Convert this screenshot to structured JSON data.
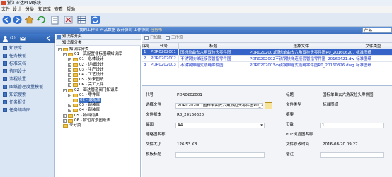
{
  "window": {
    "title": "浙江亚达PLM系统"
  },
  "menu": [
    "文件",
    "设计",
    "分类",
    "知识库",
    "查看",
    "帮助"
  ],
  "toolbar": {
    "buttons": [
      "back-icon",
      "forward-icon",
      "home-icon",
      "refresh-icon",
      "document-icon",
      "stop-icon",
      "grid-icon",
      "sync-icon"
    ]
  },
  "nav_strip": {
    "crumbs": [
      "我的工作台",
      "产品数据",
      "设计协同",
      "工作协同"
    ],
    "active": "任务书",
    "side_label": "产品"
  },
  "left_panel": {
    "badge_count": "(1)",
    "items": [
      "知识库",
      "任务模板",
      "标准文档",
      "协同设计",
      "流程设置",
      "图纸管理度量模板",
      "知识搜索",
      "任务报告",
      "任务结构图"
    ]
  },
  "tree": {
    "header": "知识库分类",
    "subheader": "知识库分类",
    "nodes": [
      {
        "label": "知识库分类",
        "toggle": "-",
        "depth": 0
      },
      {
        "label": "01 - 高配置非标图纸知识库",
        "toggle": "-",
        "depth": 1
      },
      {
        "label": "01 - 总体设计",
        "toggle": "+",
        "depth": 2
      },
      {
        "label": "02 - 详细设计",
        "toggle": "+",
        "depth": 2
      },
      {
        "label": "03 - 生产设计",
        "toggle": "+",
        "depth": 2
      },
      {
        "label": "04 - 工艺设计",
        "toggle": "+",
        "depth": 2
      },
      {
        "label": "05 - 外来图纸",
        "toggle": "+",
        "depth": 2
      },
      {
        "label": "06 - 完工文件",
        "toggle": "+",
        "depth": 2
      },
      {
        "label": "02 - 亚达管道阀门知识库",
        "toggle": "-",
        "depth": 1
      },
      {
        "label": "01 - 零件库",
        "toggle": "+",
        "depth": 2
      },
      {
        "label": "02 - 装配库",
        "toggle": "",
        "depth": 2,
        "selected": true
      },
      {
        "label": "03 - 部装库",
        "toggle": "+",
        "depth": 2
      },
      {
        "label": "04 - 部装库",
        "toggle": "+",
        "depth": 2
      },
      {
        "label": "05 - 物料词典",
        "toggle": "+",
        "depth": 1
      },
      {
        "label": "06 - 阶位背景图纸表",
        "toggle": "+",
        "depth": 1
      },
      {
        "label": "未分类",
        "toggle": "",
        "depth": 0
      }
    ]
  },
  "grid": {
    "toolbar": {
      "check1": "已加载",
      "check2": "工作流"
    },
    "columns": [
      "序号",
      "代号",
      "标题",
      "选择文件",
      "文件类型"
    ],
    "rows": [
      [
        "1",
        "PDR0202001",
        "国标单曲去六角双拉头零件图",
        "PDR0202001国标单曲去六角双拉头零件图R0_20160620.dwg",
        "标准图纸"
      ],
      [
        "2",
        "PDR0202002",
        "不锈钢扶梯连接套管指零件图",
        "PDR0202002不锈钢扶梯连接套管指零件图_20160421.dwg",
        "标准图纸"
      ],
      [
        "3",
        "PDR0202003",
        "不锈钢伸缩式缆绳零件图",
        "PDR0202003不锈钢伸缩式缆绳零件图R0_20160326.dwg",
        "标准图纸"
      ]
    ]
  },
  "detail": {
    "code_label": "代号",
    "code": "PDR0202001",
    "title_label": "标题",
    "title": "国标单曲去六角双拉头零件图",
    "file_label": "选择文件",
    "file": "PDR0202001国标单曲去六角双拉头零件图R0_20160620",
    "filetype_label": "文件类型",
    "filetype": "标准图纸",
    "version_label": "文件版本",
    "version": "R0_20160620",
    "summary_label": "摘要",
    "format_label": "幅面",
    "format": "A4",
    "pages_label": "页数",
    "pages": "1",
    "thumb_label": "缩略图名称",
    "pdf_label": "PDF浏览图名称",
    "size_label": "文件大小",
    "size": "126.53 KB",
    "date_label": "文件修改时间",
    "date": "2016-08-20 09:27",
    "template_label": "模板标题",
    "note_label": "备注"
  },
  "colors": {
    "titlebar": "#e9f0f8",
    "nav_strip": "#3c6fbe",
    "selection": "#3563c8",
    "link_text": "#1d37c7"
  }
}
